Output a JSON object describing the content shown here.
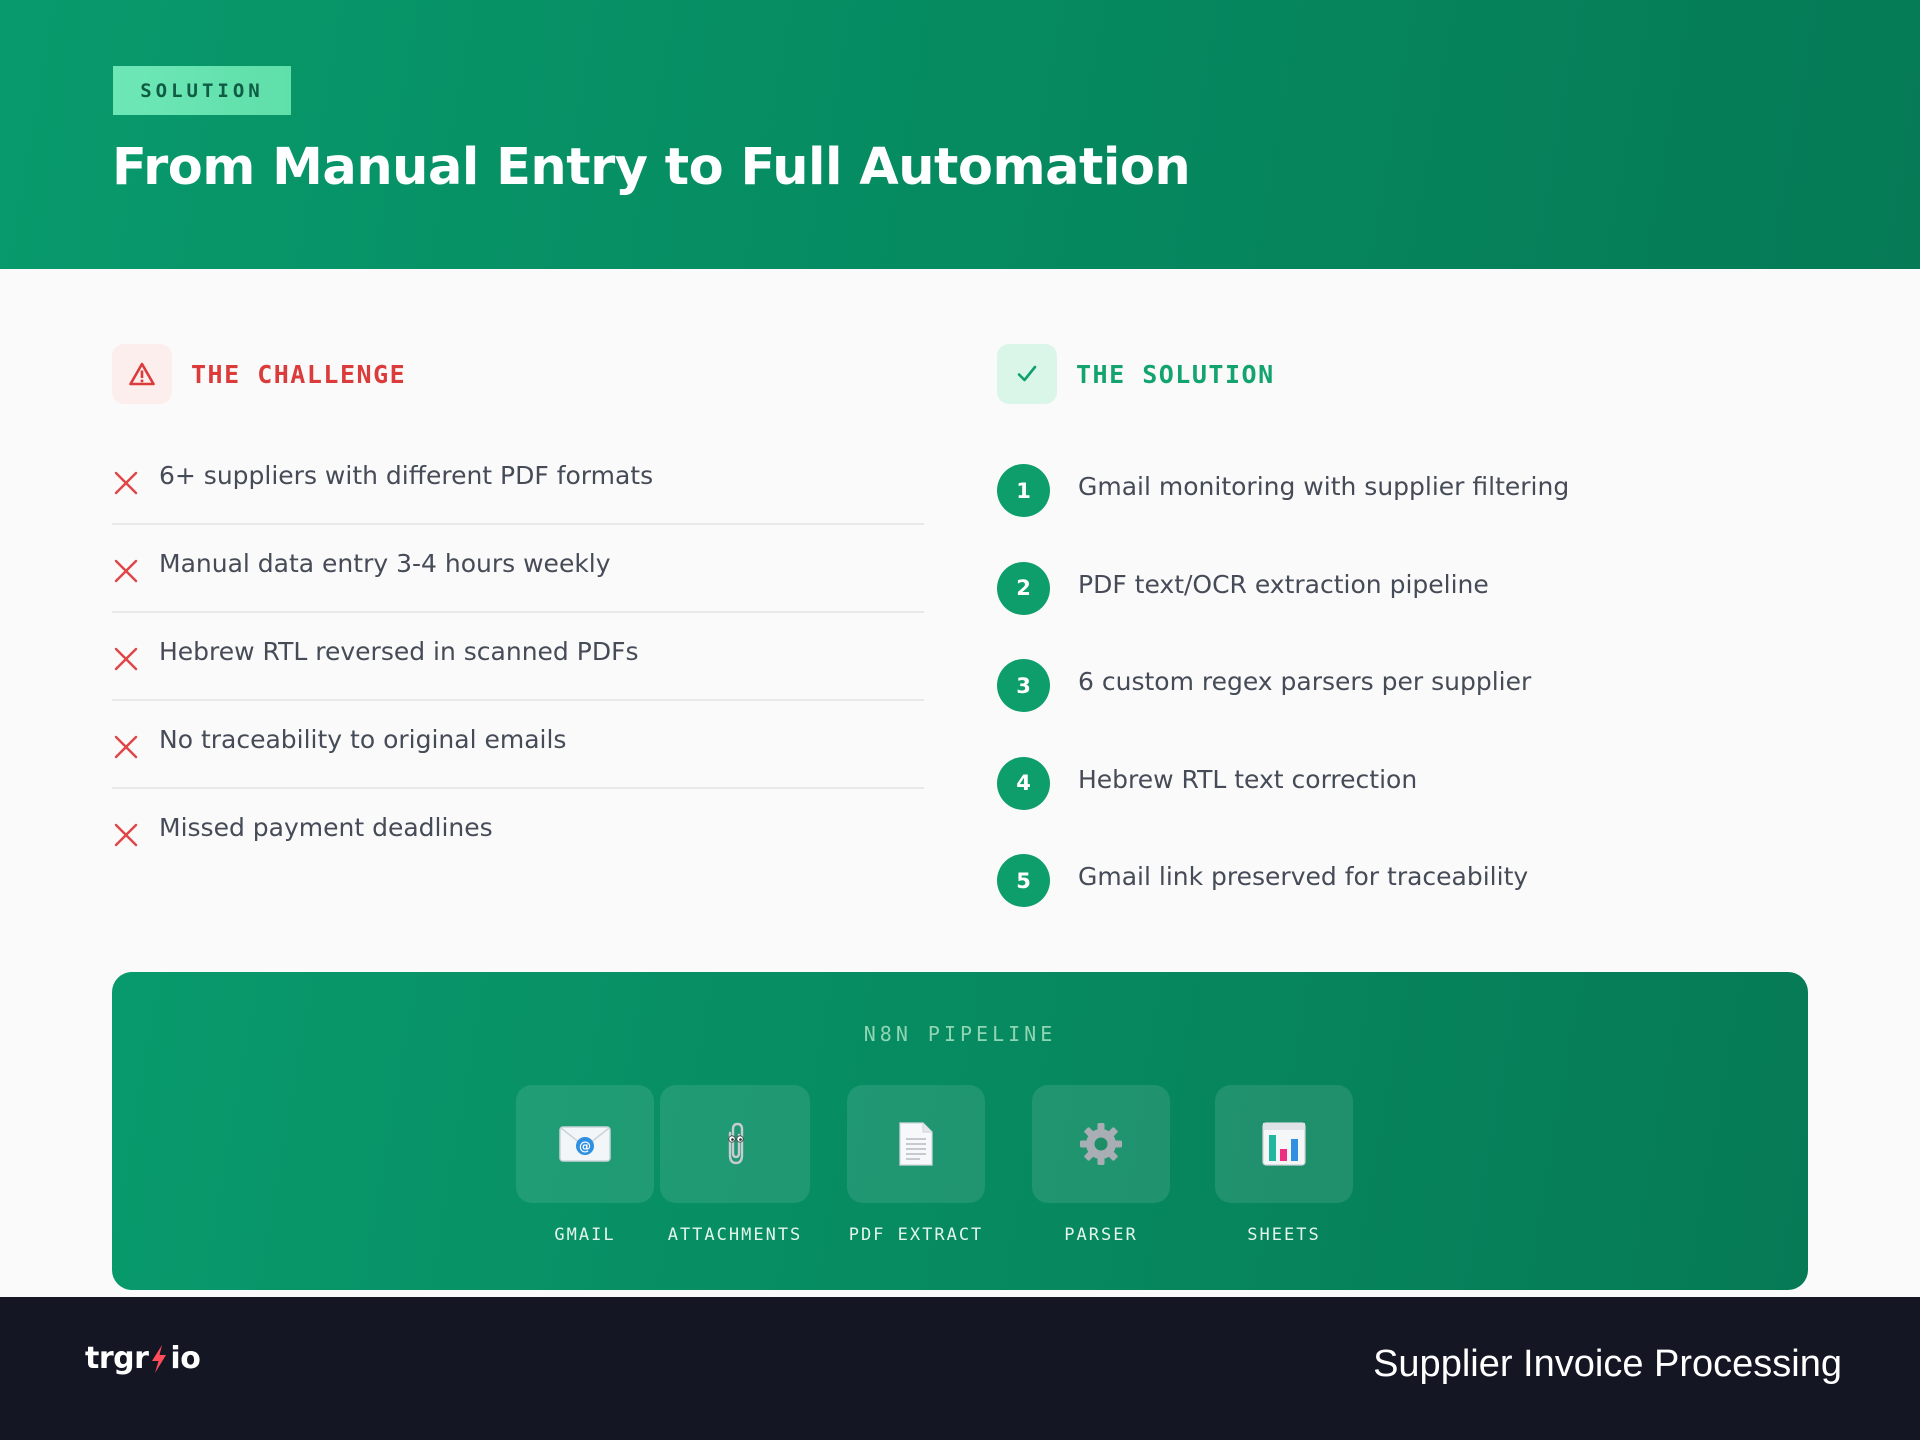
{
  "header": {
    "badge": "SOLUTION",
    "title": "From Manual Entry to Full Automation"
  },
  "challenge": {
    "heading": "THE CHALLENGE",
    "icon": "warning-icon",
    "items": [
      "6+ suppliers with different PDF formats",
      "Manual data entry 3-4 hours weekly",
      "Hebrew RTL reversed in scanned PDFs",
      "No traceability to original emails",
      "Missed payment deadlines"
    ]
  },
  "solution": {
    "heading": "THE SOLUTION",
    "icon": "check-icon",
    "items": [
      {
        "num": "1",
        "text": "Gmail monitoring with supplier filtering"
      },
      {
        "num": "2",
        "text": "PDF text/OCR extraction pipeline"
      },
      {
        "num": "3",
        "text": "6 custom regex parsers per supplier"
      },
      {
        "num": "4",
        "text": "Hebrew RTL text correction"
      },
      {
        "num": "5",
        "text": "Gmail link preserved for traceability"
      }
    ]
  },
  "pipeline": {
    "label": "N8N PIPELINE",
    "steps": [
      {
        "label": "GMAIL",
        "icon": "email-icon"
      },
      {
        "label": "ATTACHMENTS",
        "icon": "paperclip-icon"
      },
      {
        "label": "PDF EXTRACT",
        "icon": "document-icon"
      },
      {
        "label": "PARSER",
        "icon": "gear-icon"
      },
      {
        "label": "SHEETS",
        "icon": "chart-icon"
      }
    ]
  },
  "footer": {
    "logo_left": "trgr",
    "logo_right": "io",
    "title": "Supplier Invoice Processing"
  },
  "colors": {
    "brand_green": "#089a6c",
    "challenge_red": "#dc3b3b",
    "footer_dark": "#141624"
  }
}
